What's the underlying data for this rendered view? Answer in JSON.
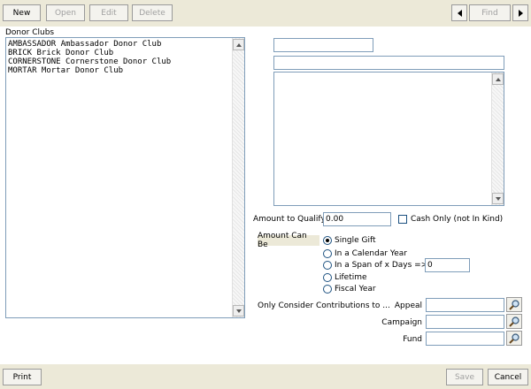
{
  "toolbar": {
    "new": "New",
    "open": "Open",
    "edit": "Edit",
    "delete": "Delete",
    "find": "Find"
  },
  "list": {
    "label": "Donor Clubs",
    "items": [
      "AMBASSADOR Ambassador Donor Club",
      "BRICK Brick Donor Club",
      "CORNERSTONE Cornerstone Donor Club",
      "MORTAR Mortar Donor Club"
    ]
  },
  "form": {
    "code_value": "",
    "name_value": "",
    "description_value": "",
    "amount_to_qualify_label": "Amount to Qualify",
    "amount_to_qualify_value": "0.00",
    "cash_only_label": "Cash Only (not In Kind)",
    "cash_only_checked": false,
    "amount_can_be_label": "Amount Can Be",
    "options": [
      "Single Gift",
      "In a Calendar Year",
      "In a Span of x Days =>",
      "Lifetime",
      "Fiscal Year"
    ],
    "selected_option": "Single Gift",
    "span_days_value": "0",
    "only_consider_label": "Only Consider Contributions to ...",
    "appeal_label": "Appeal",
    "appeal_value": "",
    "campaign_label": "Campaign",
    "campaign_value": "",
    "fund_label": "Fund",
    "fund_value": ""
  },
  "footer": {
    "print": "Print",
    "save": "Save",
    "cancel": "Cancel"
  },
  "icons": {
    "find_prev": "triangle-left-icon",
    "find_next": "triangle-right-icon",
    "lookup": "magnifier-icon"
  },
  "colors": {
    "toolbar_bg": "#ece9d8",
    "field_border": "#7f9db9"
  }
}
